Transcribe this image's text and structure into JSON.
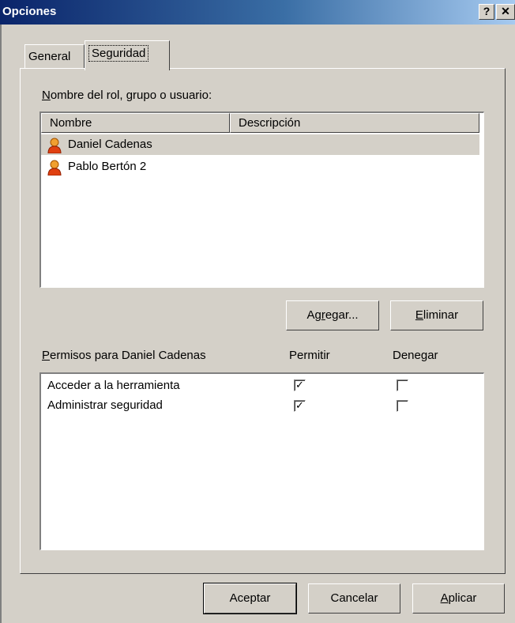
{
  "window": {
    "title": "Opciones",
    "help_label": "?",
    "close_label": "✕"
  },
  "tabs": [
    {
      "label": "General"
    },
    {
      "label": "Seguridad"
    }
  ],
  "roles": {
    "label_mnemonic": "N",
    "label_rest": "ombre del rol, grupo o usuario:",
    "columns": [
      {
        "label": "Nombre"
      },
      {
        "label": "Descripción"
      }
    ],
    "rows": [
      {
        "name": "Daniel Cadenas",
        "icon": "user-icon",
        "selected": true
      },
      {
        "name": "Pablo Bertón 2",
        "icon": "user-icon",
        "selected": false
      }
    ],
    "add_mnemonic_pre": "Ag",
    "add_mnemonic": "r",
    "add_rest": "egar...",
    "remove_mnemonic": "E",
    "remove_rest": "liminar"
  },
  "permissions": {
    "label_mnemonic": "P",
    "label_rest": "ermisos para Daniel Cadenas",
    "allow_header": "Permitir",
    "deny_header": "Denegar",
    "items": [
      {
        "label": "Acceder a la herramienta",
        "allow": true,
        "deny": false
      },
      {
        "label": "Administrar seguridad",
        "allow": true,
        "deny": false
      }
    ]
  },
  "footer": {
    "ok_label": "Aceptar",
    "cancel_label": "Cancelar",
    "apply_mnemonic": "A",
    "apply_rest": "plicar"
  }
}
